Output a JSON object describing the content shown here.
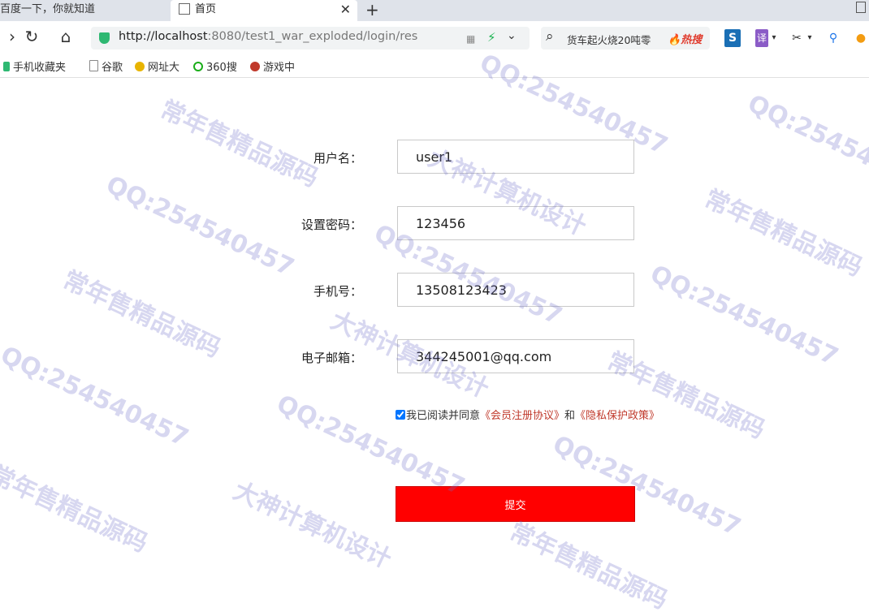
{
  "tabs": [
    {
      "label": "百度一下，你就知道",
      "active": false
    },
    {
      "label": "首页",
      "active": true
    }
  ],
  "toolbar": {
    "url_host": "http://localhost",
    "url_rest": ":8080/test1_war_exploded/login/res",
    "search_query": "货车起火烧20吨零",
    "search_hot": "热搜",
    "translate_label": "译"
  },
  "bookmarks": [
    {
      "label": "手机收藏夹",
      "icon": "phone-icon",
      "color": "#2eb872"
    },
    {
      "label": "谷歌",
      "icon": "page-icon",
      "color": "#888888"
    },
    {
      "label": "网址大",
      "icon": "globe-icon",
      "color": "#e8b400"
    },
    {
      "label": "360搜",
      "icon": "search-360-icon",
      "color": "#1aad19"
    },
    {
      "label": "游戏中",
      "icon": "game-icon",
      "color": "#c0392b"
    }
  ],
  "form": {
    "username_label": "用户名：",
    "username_value": "user1",
    "password_label": "设置密码：",
    "password_value": "123456",
    "phone_label": "手机号：",
    "phone_value": "13508123423",
    "email_label": "电子邮箱：",
    "email_value": "344245001@qq.com",
    "agree_prefix": "我已阅读并同意",
    "agree_link1": "《会员注册协议》",
    "agree_and": "和",
    "agree_link2": "《隐私保护政策》",
    "submit_label": "提交"
  },
  "watermark": {
    "text1": "常年售精品源码",
    "text2": "QQ:254540457",
    "text3": "大神计算机设计"
  },
  "colors": {
    "submit": "#ff0000",
    "link": "#c0392b",
    "watermark": "#6e6ec8"
  }
}
